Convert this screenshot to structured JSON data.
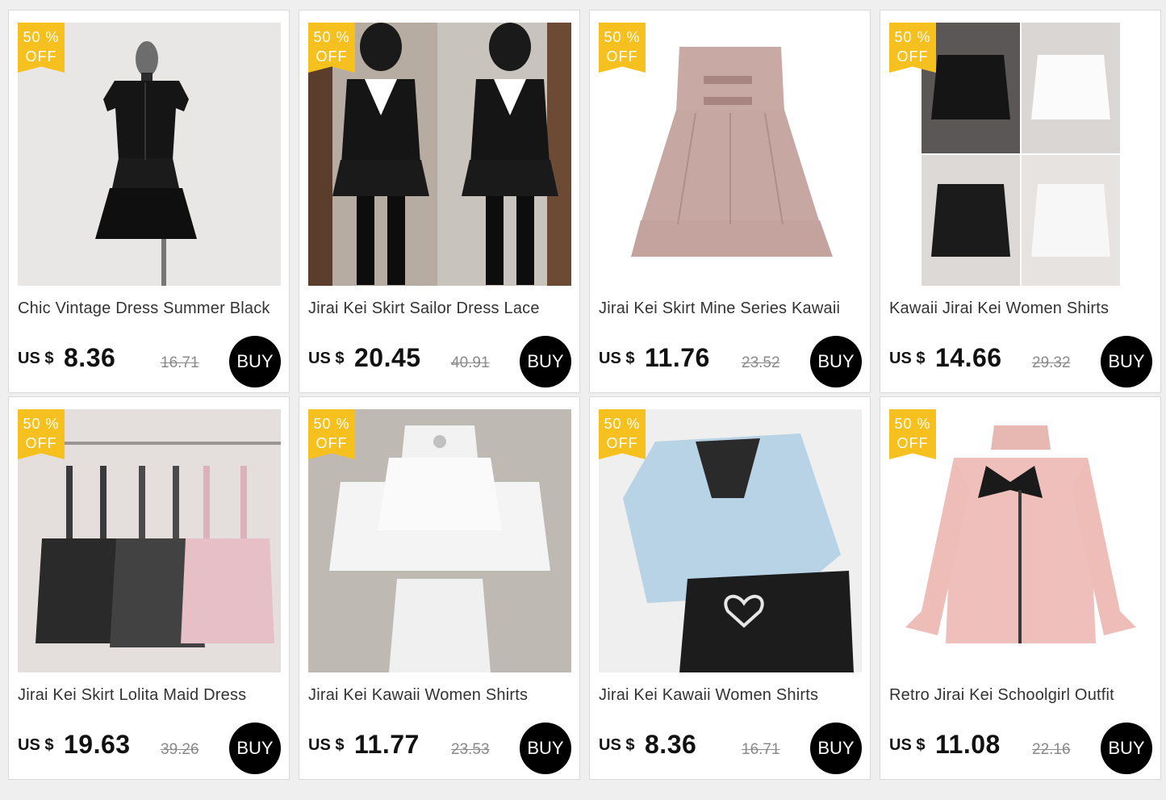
{
  "labels": {
    "discount_top": "50 %",
    "discount_bottom": "OFF",
    "currency": "US $",
    "buy": "BUY"
  },
  "products": [
    {
      "title": "Chic Vintage Dress Summer Black",
      "price": "8.36",
      "old_price": "16.71",
      "image": "black-dress-on-mannequin"
    },
    {
      "title": "Jirai Kei Skirt Sailor Dress Lace",
      "price": "20.45",
      "old_price": "40.91",
      "image": "sailor-dress-mirror-photo"
    },
    {
      "title": "Jirai Kei Skirt Mine Series Kawaii",
      "price": "11.76",
      "old_price": "23.52",
      "image": "pink-pleated-skirt"
    },
    {
      "title": "Kawaii Jirai Kei Women Shirts",
      "price": "14.66",
      "old_price": "29.32",
      "image": "ruffle-shirts-collage"
    },
    {
      "title": "Jirai Kei Skirt Lolita Maid Dress",
      "price": "19.63",
      "old_price": "39.26",
      "image": "suspender-skirts-on-hangers"
    },
    {
      "title": "Jirai Kei Kawaii Women Shirts",
      "price": "11.77",
      "old_price": "23.53",
      "image": "white-ruffle-blouse"
    },
    {
      "title": "Jirai Kei Kawaii Women Shirts",
      "price": "8.36",
      "old_price": "16.71",
      "image": "blue-lace-blouse"
    },
    {
      "title": "Retro Jirai Kei Schoolgirl Outfit",
      "price": "11.08",
      "old_price": "22.16",
      "image": "pink-blouse-black-bow"
    }
  ],
  "colors": {
    "badge": "#f6c01e",
    "buy_button": "#000000",
    "page_background": "#efefef"
  }
}
